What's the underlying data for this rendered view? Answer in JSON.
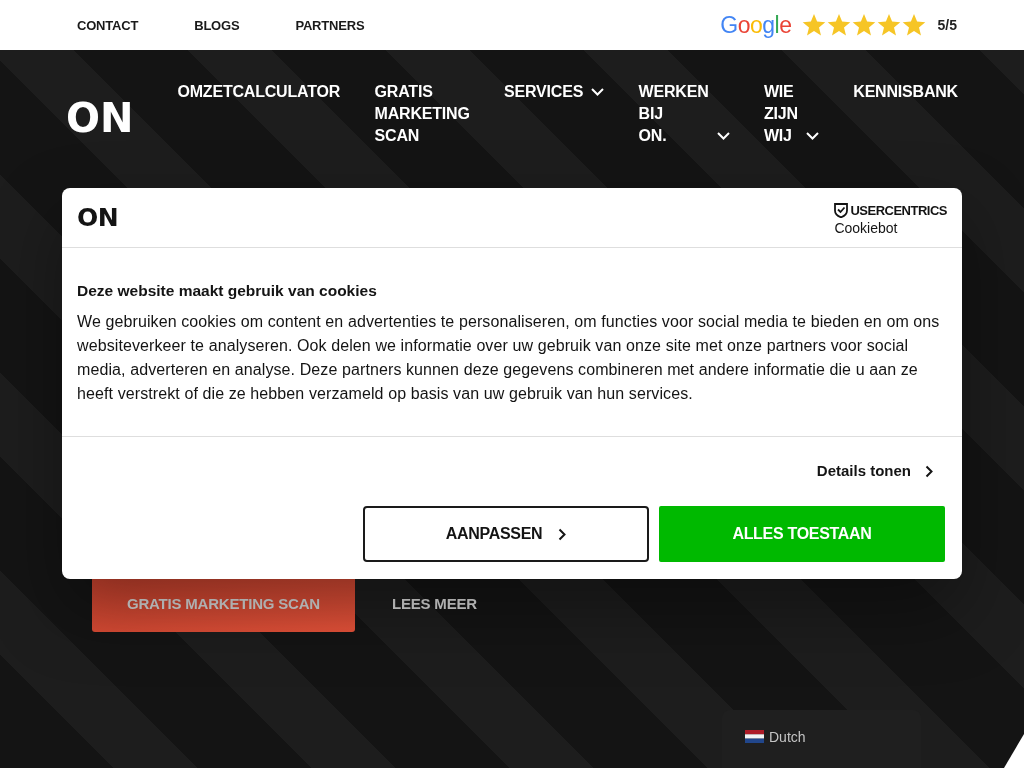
{
  "top_bar": {
    "links": [
      "CONTACT",
      "BLOGS",
      "PARTNERS"
    ],
    "rating": {
      "brand": "Google",
      "stars": 5,
      "score": "5/5"
    }
  },
  "header": {
    "logo": "ON",
    "nav": [
      {
        "label": "OMZETCALCULATOR",
        "dropdown": false
      },
      {
        "label": "GRATIS MARKETING SCAN",
        "dropdown": false
      },
      {
        "label": "SERVICES",
        "dropdown": true
      },
      {
        "label": "WERKEN BIJ ON.",
        "dropdown": true
      },
      {
        "label": "WIE ZIJN WIJ",
        "dropdown": true
      },
      {
        "label": "KENNISBANK",
        "dropdown": false
      }
    ]
  },
  "hero": {
    "buttons": [
      {
        "label": "GRATIS MARKETING SCAN",
        "kind": "primary"
      },
      {
        "label": "LEES MEER",
        "kind": "link"
      }
    ]
  },
  "cookie_dialog": {
    "logo": "ON",
    "provider": {
      "name": "USERCENTRICS",
      "product": "Cookiebot"
    },
    "title": "Deze website maakt gebruik van cookies",
    "text": "We gebruiken cookies om content en advertenties te personaliseren, om functies voor social media te bieden en om ons websiteverkeer te analyseren. Ook delen we informatie over uw gebruik van onze site met onze partners voor social media, adverteren en analyse. Deze partners kunnen deze gegevens combineren met andere informatie die u aan ze heeft verstrekt of die ze hebben verzameld op basis van uw gebruik van hun services.",
    "details_link": "Details tonen",
    "buttons": [
      {
        "label": "AANPASSEN",
        "kind": "outline"
      },
      {
        "label": "ALLES TOESTAAN",
        "kind": "primary"
      }
    ]
  },
  "language_switcher": {
    "label": "Dutch"
  }
}
